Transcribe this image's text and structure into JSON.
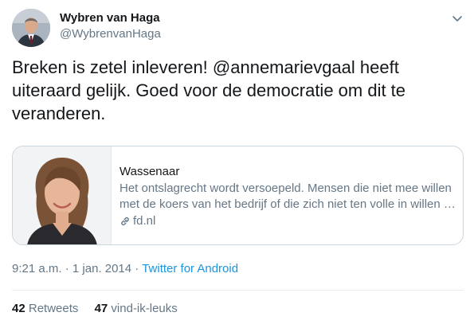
{
  "author": {
    "name": "Wybren van Haga",
    "handle": "@WybrenvanHaga"
  },
  "tweet": {
    "text_part1": "Breken is zetel inleveren! ",
    "mention": "@annemarievgaal",
    "text_part2": " heeft uiteraard gelijk. Goed voor de democratie om dit te veranderen."
  },
  "card": {
    "title": "Wassenaar",
    "description_line1": "Het ontslagrecht wordt versoepeld. Mensen die niet mee willen",
    "description_line2": "met de koers van het bedrijf of die zich niet ten volle in willen …",
    "domain": "fd.nl"
  },
  "meta": {
    "time": "9:21 a.m.",
    "separator": " · ",
    "date": "1 jan. 2014",
    "source": "Twitter for Android"
  },
  "stats": {
    "retweets_count": "42",
    "retweets_label": "Retweets",
    "likes_count": "47",
    "likes_label": "vind-ik-leuks"
  },
  "colors": {
    "link": "#1b95e0",
    "secondary_text": "#657786",
    "border": "#ccd6dd"
  }
}
